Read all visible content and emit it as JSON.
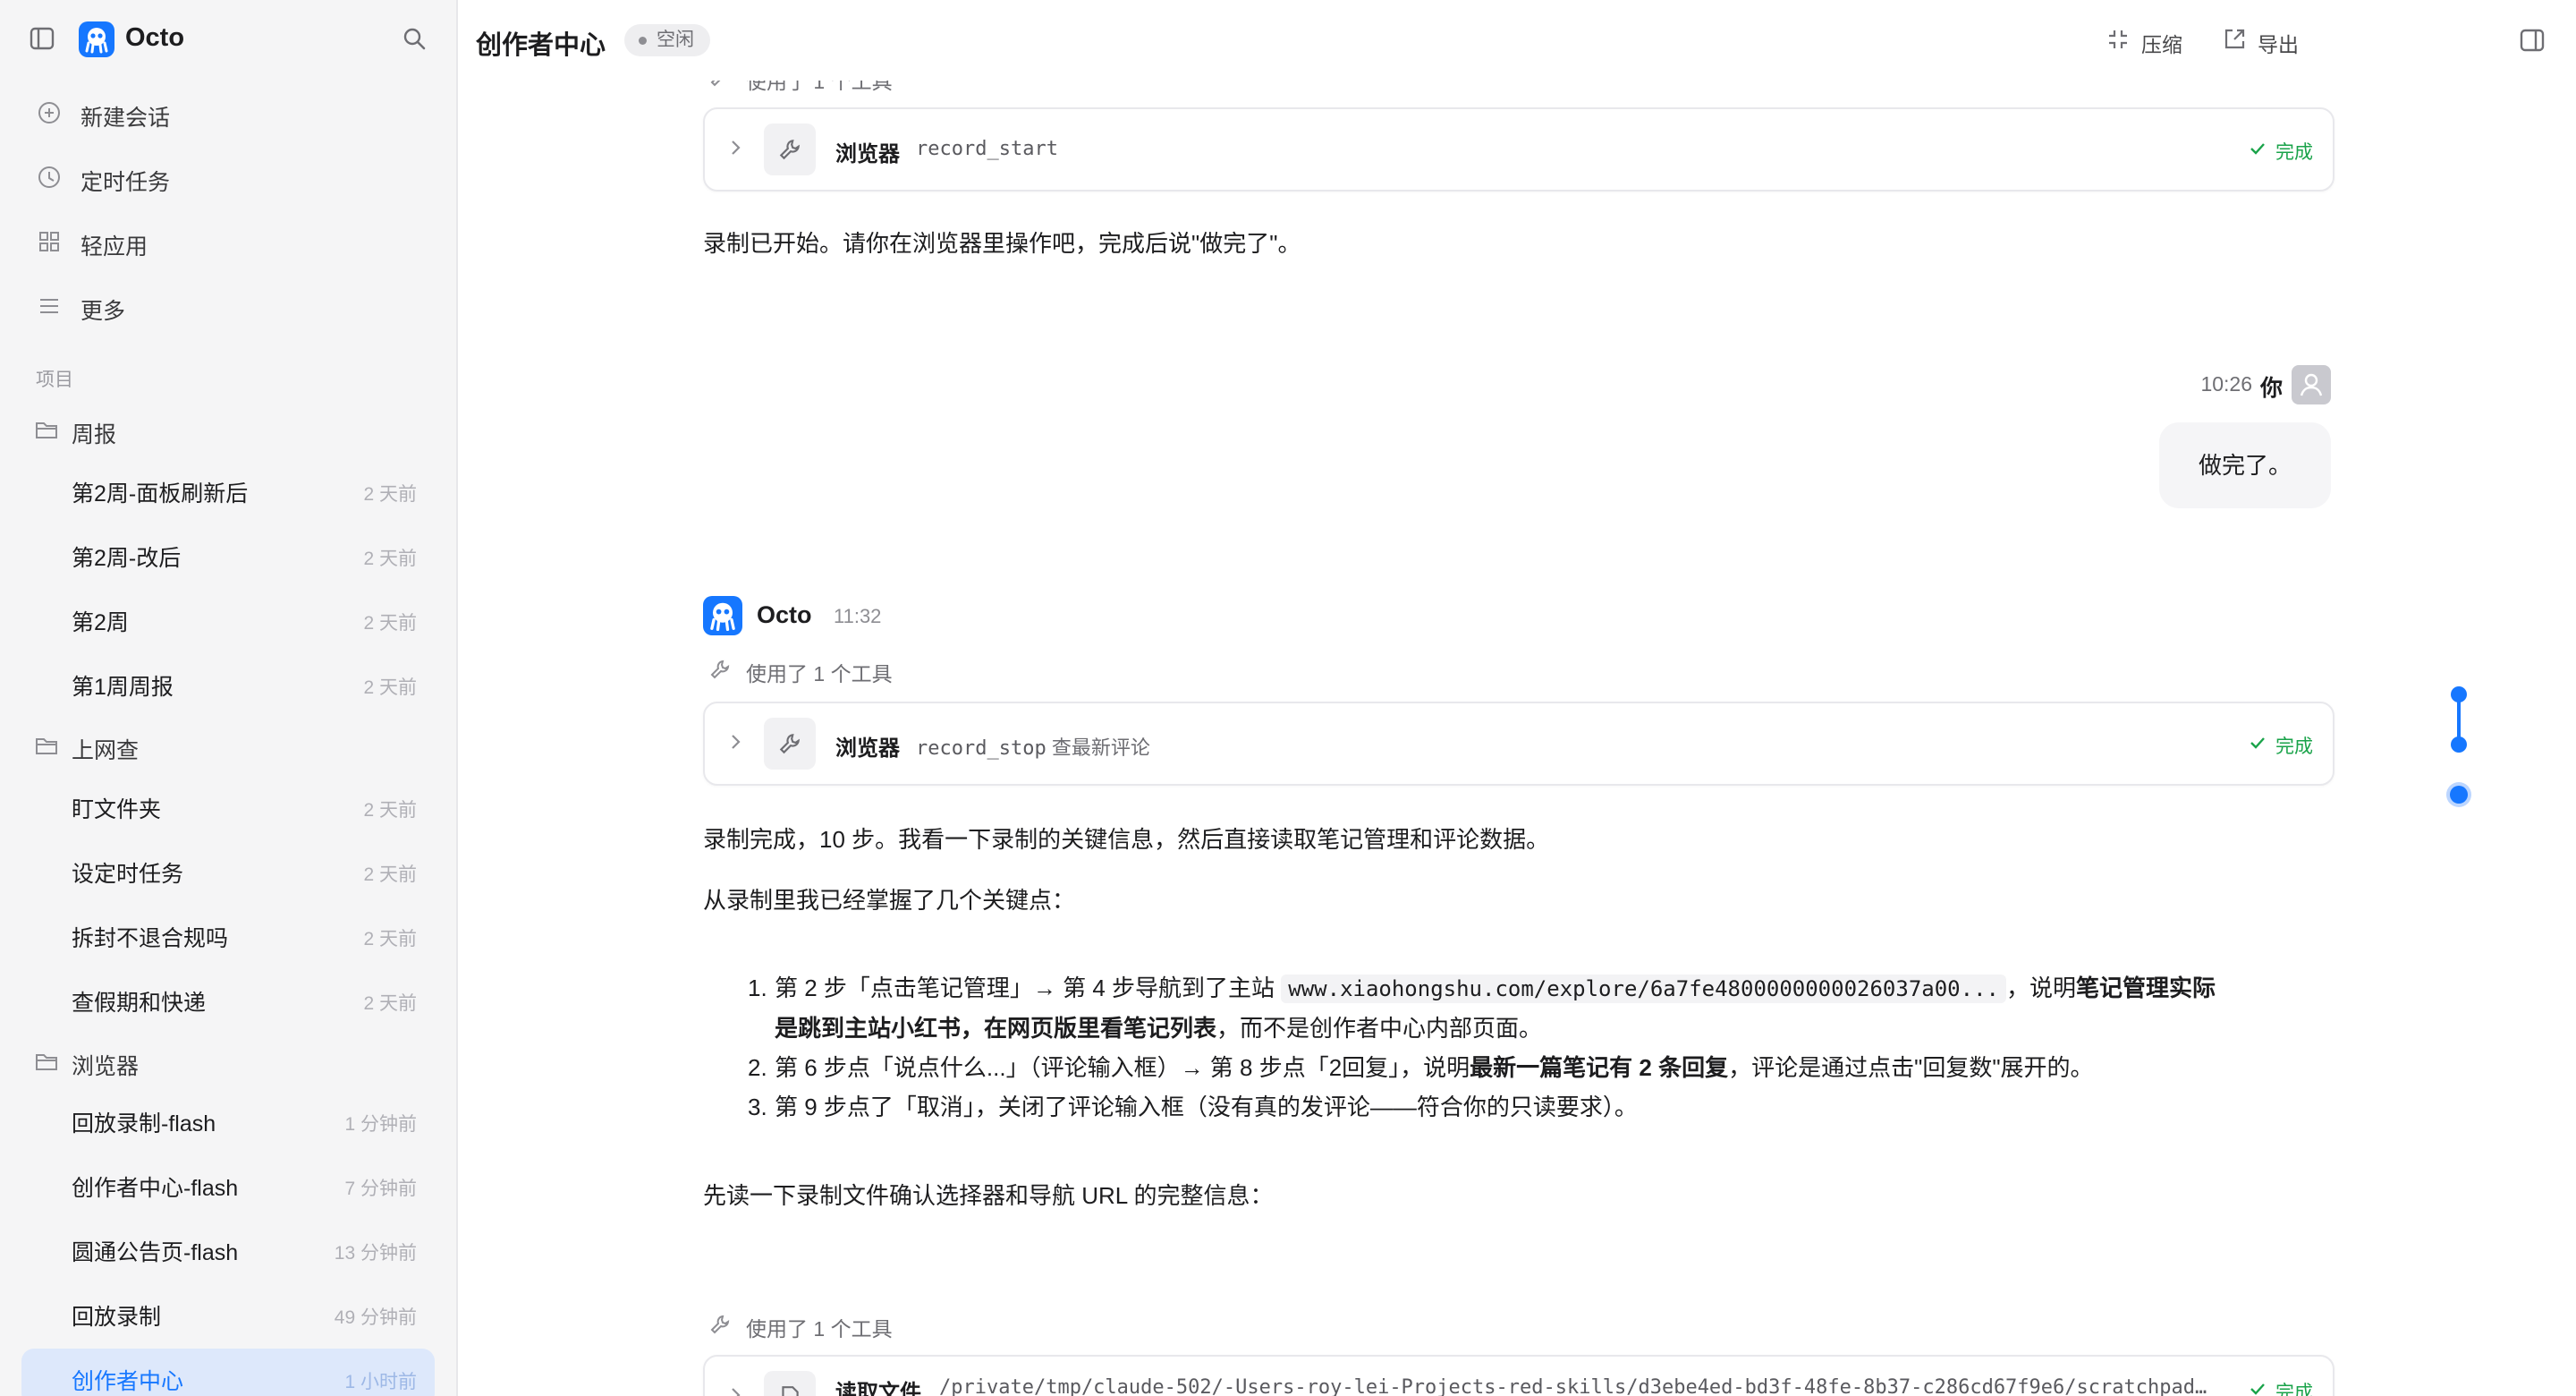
{
  "sidebar": {
    "brand": "Octo",
    "nav": [
      {
        "label": "新建会话",
        "icon": "plus-circle-icon"
      },
      {
        "label": "定时任务",
        "icon": "clock-icon"
      },
      {
        "label": "轻应用",
        "icon": "grid-icon"
      },
      {
        "label": "更多",
        "icon": "menu-icon"
      }
    ],
    "section_label": "项目",
    "folders": [
      {
        "name": "周报",
        "items": [
          {
            "label": "第2周-面板刷新后",
            "time": "2 天前"
          },
          {
            "label": "第2周-改后",
            "time": "2 天前"
          },
          {
            "label": "第2周",
            "time": "2 天前"
          },
          {
            "label": "第1周周报",
            "time": "2 天前"
          }
        ]
      },
      {
        "name": "上网查",
        "items": [
          {
            "label": "盯文件夹",
            "time": "2 天前"
          },
          {
            "label": "设定时任务",
            "time": "2 天前"
          },
          {
            "label": "拆封不退合规吗",
            "time": "2 天前"
          },
          {
            "label": "查假期和快递",
            "time": "2 天前"
          }
        ]
      },
      {
        "name": "浏览器",
        "items": [
          {
            "label": "回放录制-flash",
            "time": "1 分钟前"
          },
          {
            "label": "创作者中心-flash",
            "time": "7 分钟前"
          },
          {
            "label": "圆通公告页-flash",
            "time": "13 分钟前"
          },
          {
            "label": "回放录制",
            "time": "49 分钟前"
          },
          {
            "label": "创作者中心",
            "time": "1 小时前"
          }
        ]
      }
    ]
  },
  "header": {
    "title": "创作者中心",
    "status": "空闲",
    "compress_label": "压缩",
    "export_label": "导出"
  },
  "chat": {
    "tool_used_label": "使用了 1 个工具",
    "tool1": {
      "name": "浏览器",
      "arg": "record_start",
      "desc": "",
      "status": "完成"
    },
    "msg1": "录制已开始。请你在浏览器里操作吧，完成后说\"做完了\"。",
    "user": {
      "time": "10:26",
      "name": "你",
      "text": "做完了。"
    },
    "bot": {
      "name": "Octo",
      "time": "11:32"
    },
    "tool2": {
      "name": "浏览器",
      "arg": "record_stop",
      "desc": "查最新评论",
      "status": "完成"
    },
    "msg2": "录制完成，10 步。我看一下录制的关键信息，然后直接读取笔记管理和评论数据。",
    "msg3": "从录制里我已经掌握了几个关键点：",
    "list": {
      "i1": {
        "num": "1.",
        "a": "第 2 步「点击笔记管理」→ 第 4 步导航到了主站 ",
        "code": "www.xiaohongshu.com/explore/6a7fe4800000000026037a00...",
        "b": "，说明",
        "bold1": "笔记管理实际",
        "bold2": "是跳到主站小红书，在网页版里看笔记列表",
        "c": "，而不是创作者中心内部页面。"
      },
      "i2": {
        "num": "2.",
        "a": "第 6 步点「说点什么...」（评论输入框）→ 第 8 步点「2回复」，说明",
        "bold": "最新一篇笔记有 2 条回复",
        "b": "，评论是通过点击\"回复数\"展开的。"
      },
      "i3": {
        "num": "3.",
        "a": "第 9 步点了「取消」，关闭了评论输入框（没有真的发评论——符合你的只读要求）。"
      }
    },
    "msg4": "先读一下录制文件确认选择器和导航 URL 的完整信息：",
    "tool3": {
      "name": "读取文件",
      "arg": "/private/tmp/claude-502/-Users-roy-lei-Projects-red-skills/d3ebe4ed-bd3f-48fe-8b37-c286cd67f9e6/scratchpad/...",
      "status": "完成"
    }
  },
  "colors": {
    "accent": "#1677ff",
    "success": "#1aa34a",
    "active_bg": "#dde8fb"
  }
}
